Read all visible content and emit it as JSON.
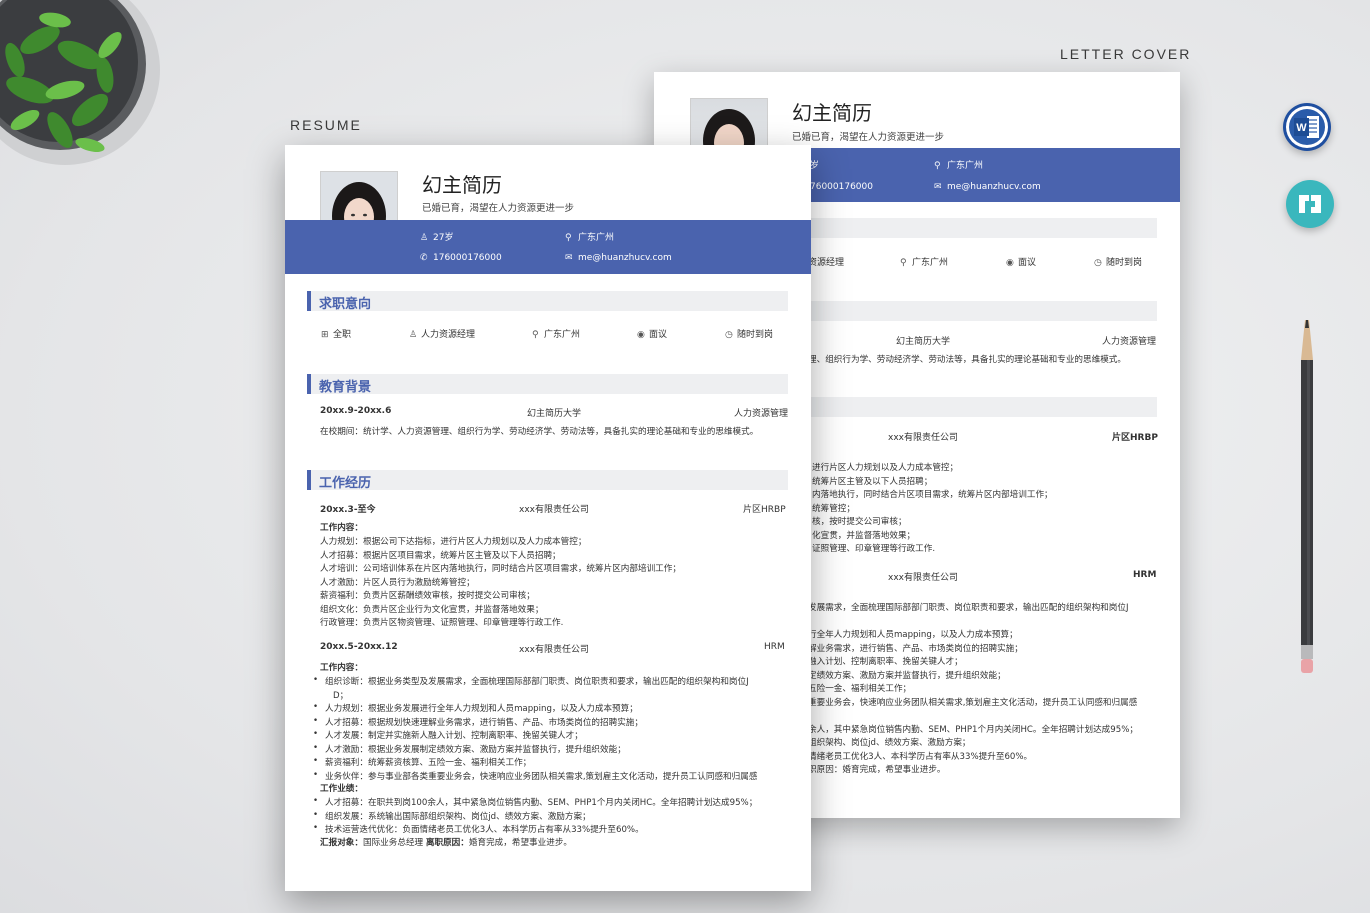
{
  "captions": {
    "letter": "LETTER COVER",
    "resume": "RESUME"
  },
  "icons": {
    "word": "word-app-icon",
    "other": "document-app-icon"
  },
  "colors": {
    "accent": "#4a63ae",
    "section_bg": "#eeeff1"
  },
  "resume": {
    "name": "幻主简历",
    "slogan": "已婚已育，渴望在人力资源更进一步",
    "age": "27岁",
    "location": "广东广州",
    "phone": "176000176000",
    "email": "me@huanzhucv.com",
    "sections": {
      "intent": "求职意向",
      "education": "教育背景",
      "work": "工作经历"
    },
    "intent": [
      "全职",
      "人力资源经理",
      "广东广州",
      "面议",
      "随时到岗"
    ],
    "education": {
      "period": "20xx.9-20xx.6",
      "school": "幻主简历大学",
      "major": "人力资源管理",
      "desc": "在校期间：统计学、人力资源管理、组织行为学、劳动经济学、劳动法等，具备扎实的理论基础和专业的思维模式。"
    },
    "jobs": [
      {
        "period": "20xx.3-至今",
        "company": "xxx有限责任公司",
        "title": "片区HRBP",
        "content_label": "工作内容：",
        "lines": [
          "人力规划：根据公司下达指标，进行片区人力规划以及人力成本管控；",
          "人才招募：根据片区项目需求，统筹片区主管及以下人员招聘；",
          "人才培训：公司培训体系在片区内落地执行，同时结合片区项目需求，统筹片区内部培训工作；",
          "人才激励：片区人员行为激励统筹管控；",
          "薪资福利：负责片区薪酬绩效审核，按时提交公司审核；",
          "组织文化：负责片区企业行为文化宣贯，并监督落地效果；",
          "行政管理：负责片区物资管理、证照管理、印章管理等行政工作."
        ]
      },
      {
        "period": "20xx.5-20xx.12",
        "company": "xxx有限责任公司",
        "title": "HRM",
        "content_label": "工作内容：",
        "bullets": [
          "组织诊断：根据业务类型及发展需求，全面梳理国际部部门职责、岗位职责和要求，输出匹配的组织架构和岗位J",
          "D；",
          "人力规划：根据业务发展进行全年人力规划和人员mapping，以及人力成本预算；",
          "人才招募：根据规划快速理解业务需求，进行销售、产品、市场类岗位的招聘实施；",
          "人才发展：制定并实施新人融入计划、控制离职率、挽留关键人才；",
          "人才激励：根据业务发展制定绩效方案、激励方案并监督执行，提升组织效能；",
          "薪资福利：统筹薪资核算、五险一金、福利相关工作；",
          "业务伙伴：参与事业部各类重要业务会，快速响应业务团队相关需求,策划雇主文化活动，提升员工认同感和归属感"
        ],
        "achieve_label": "工作业绩：",
        "achieve": [
          "人才招募：在职共到岗100余人，其中紧急岗位销售内勤、SEM、PHP1个月内关闭HC。全年招聘计划达成95%；",
          "组织发展：系统输出国际部组织架构、岗位jd、绩效方案、激励方案；",
          "技术运营迭代优化：负面情绪老员工优化3人、本科学历占有率从33%提升至60%。"
        ],
        "report_label": "汇报对象：",
        "report": "国际业务总经理",
        "leave_label": "离职原因：",
        "leave": "婚育完成，希望事业进步。"
      }
    ]
  },
  "back": {
    "name": "幻主简历",
    "slogan": "已婚已育，渴望在人力资源更进一步",
    "age_frag": "岁",
    "location": "广东广州",
    "phone_frag": "76000176000",
    "email": "me@huanzhucv.com",
    "intent_frags": [
      "资源经理",
      "广东广州",
      "面议",
      "随时到岗"
    ],
    "edu_school": "幻主简历大学",
    "edu_major": "人力资源管理",
    "edu_desc_frag": "理、组织行为学、劳动经济学、劳动法等，具备扎实的理论基础和专业的思维模式。",
    "job1_company": "xxx有限责任公司",
    "job1_title": "片区HRBP",
    "job1_frags": [
      "进行片区人力规划以及人力成本管控；",
      "统筹片区主管及以下人员招聘；",
      "内落地执行，同时结合片区项目需求，统筹片区内部培训工作；",
      "统筹管控；",
      "核，按时提交公司审核；",
      "化宣贯，并监督落地效果；",
      "证照管理、印章管理等行政工作."
    ],
    "job2_company": "xxx有限责任公司",
    "job2_title": "HRM",
    "job2_frags": [
      "发展需求，全面梳理国际部部门职责、岗位职责和要求，输出匹配的组织架构和岗位J",
      "行全年人力规划和人员mapping，以及人力成本预算；",
      "解业务需求，进行销售、产品、市场类岗位的招聘实施；",
      "融入计划、控制离职率、挽留关键人才；",
      "定绩效方案、激励方案并监督执行，提升组织效能；",
      "五险一金、福利相关工作；",
      "重要业务会，快速响应业务团队相关需求,策划雇主文化活动，提升员工认同感和归属感",
      "余人，其中紧急岗位销售内勤、SEM、PHP1个月内关闭HC。全年招聘计划达成95%；",
      "组织架构、岗位jd、绩效方案、激励方案；",
      "情绪老员工优化3人、本科学历占有率从33%提升至60%。",
      "职原因：婚育完成，希望事业进步。"
    ]
  }
}
